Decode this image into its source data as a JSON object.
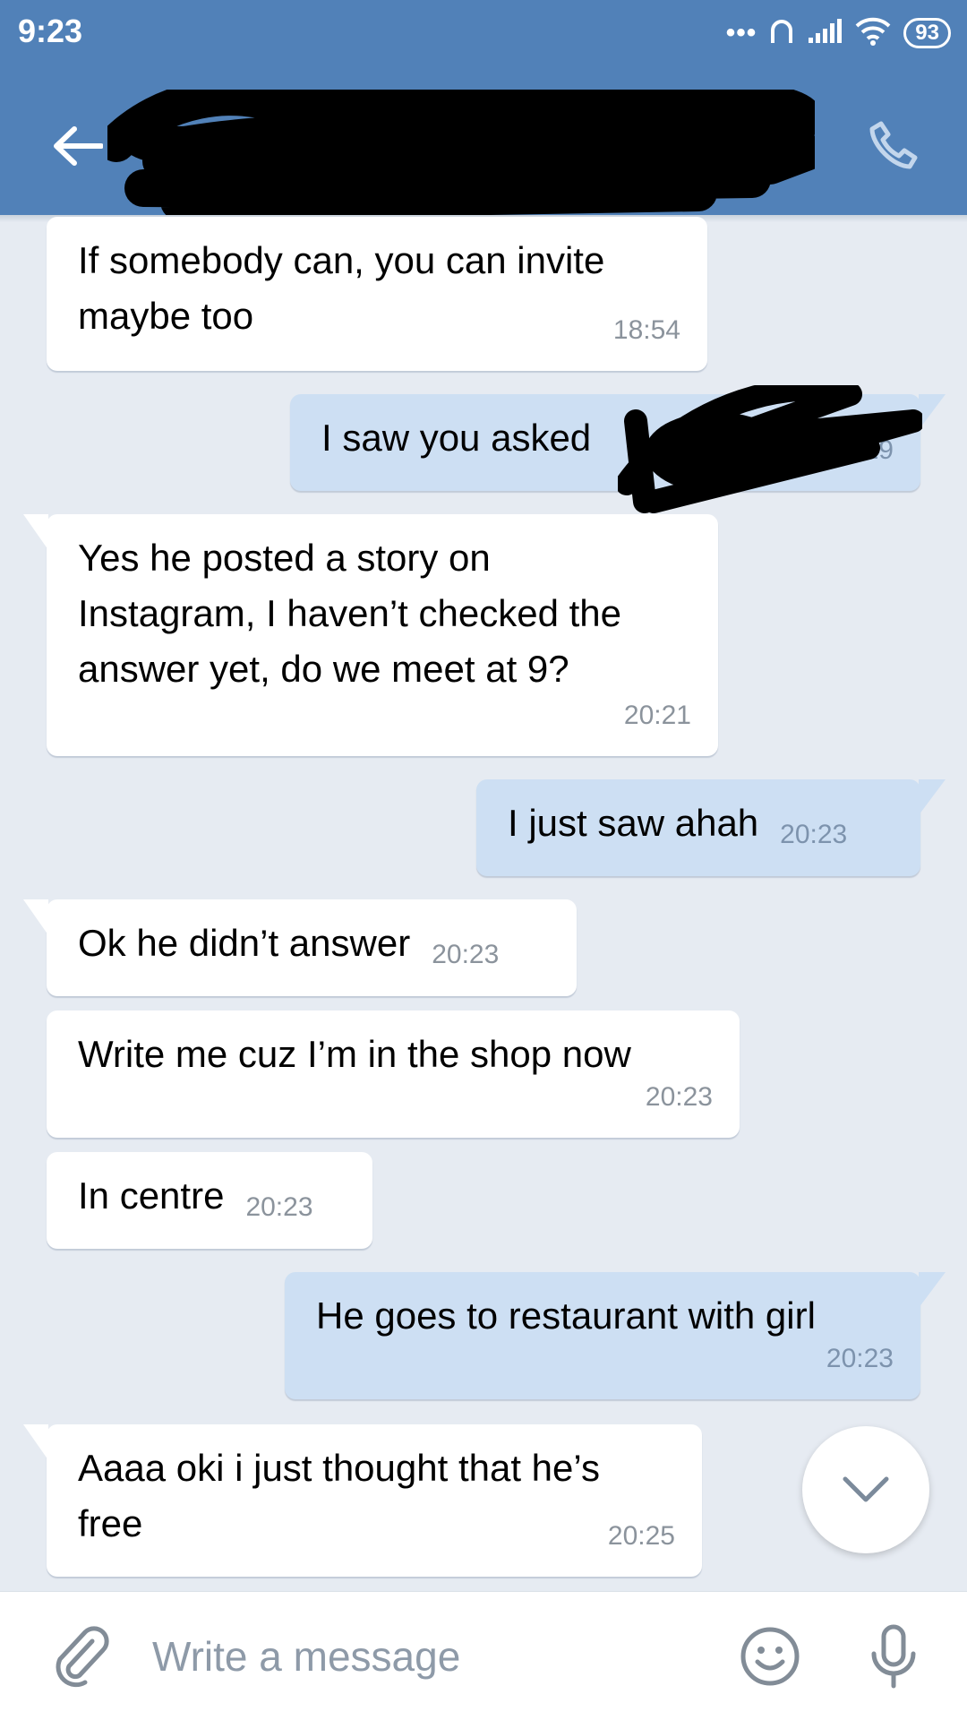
{
  "status_bar": {
    "time": "9:23",
    "battery": "93",
    "dots": "•••"
  },
  "colors": {
    "header": "#5181b8",
    "incoming_bubble": "#ffffff",
    "outgoing_bubble": "#cddff3",
    "background": "#e6ebf2"
  },
  "messages": [
    {
      "direction": "in",
      "text": "If somebody can, you can invite\nmaybe too",
      "time": "18:54"
    },
    {
      "direction": "out",
      "text": "I saw you asked",
      "time": "20:19"
    },
    {
      "direction": "in",
      "text": "Yes he posted a story on\nInstagram, I haven’t checked the\nanswer yet, do we meet at 9?",
      "time": "20:21"
    },
    {
      "direction": "out",
      "text": "I just saw ahah",
      "time": "20:23"
    },
    {
      "direction": "in",
      "text": "Ok he didn’t answer",
      "time": "20:23"
    },
    {
      "direction": "in",
      "text": "Write me cuz I’m in the shop now",
      "time": "20:23"
    },
    {
      "direction": "in",
      "text": "In centre",
      "time": "20:23"
    },
    {
      "direction": "out",
      "text": "He goes to restaurant with girl",
      "time": "20:23"
    },
    {
      "direction": "in",
      "text": "Aaaa oki i just thought that he’s\nfree",
      "time": "20:25"
    }
  ],
  "composer": {
    "placeholder": "Write a message"
  },
  "icons": {
    "back": "arrow-left-icon",
    "call": "phone-icon",
    "attach": "paperclip-icon",
    "emoji": "smile-icon",
    "mic": "microphone-icon",
    "scroll_down": "chevron-down-icon"
  }
}
